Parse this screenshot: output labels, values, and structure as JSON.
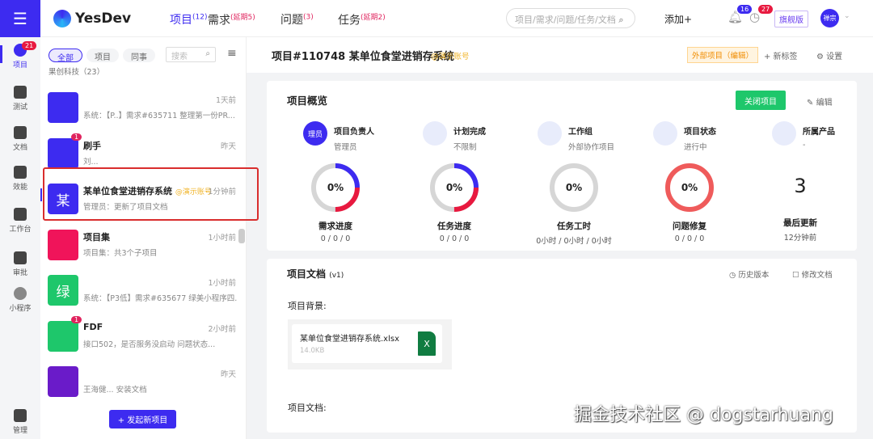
{
  "nav": {
    "logo": "YesDev",
    "tabs": [
      {
        "label": "项目",
        "count": "(12)"
      },
      {
        "label": "需求",
        "count": "(延期5)"
      },
      {
        "label": "问题",
        "count": "(3)"
      },
      {
        "label": "任务",
        "count": "(延期2)"
      }
    ],
    "search_placeholder": "项目/需求/问题/任务/文档",
    "add": "添加+",
    "bell_count": "16",
    "clock_count": "27",
    "edition": "旗舰版",
    "avatar": "禅宗"
  },
  "rail": [
    {
      "label": "项目",
      "badge": "21"
    },
    {
      "label": "测试"
    },
    {
      "label": "文档"
    },
    {
      "label": "效能"
    },
    {
      "label": "工作台"
    },
    {
      "label": "审批"
    },
    {
      "label": "小程序"
    },
    {
      "label": "管理"
    }
  ],
  "list": {
    "filters": [
      "全部",
      "项目",
      "同事"
    ],
    "search_placeholder": "搜索",
    "group": "果创科技（23）",
    "new_button": "+ 发起新项目",
    "items": [
      {
        "title": "",
        "sub": "系统：【P..】需求#635711 整理第一份PR...",
        "time": "1天前",
        "color": "#3d2bf0",
        "avatar": ""
      },
      {
        "title": "刷手",
        "sub": "刘...",
        "time": "昨天",
        "color": "#3d2bf0",
        "avatar": "",
        "badge": "1"
      },
      {
        "title": "某单位食堂进销存系统",
        "tag": "@演示账号",
        "sub": "管理员：更新了项目文档",
        "time": "1分钟前",
        "color": "#3d2bf0",
        "avatar": "某"
      },
      {
        "title": "项目集",
        "sub": "项目集：共3个子项目",
        "time": "1小时前",
        "color": "#f0145a",
        "avatar": ""
      },
      {
        "title": "",
        "sub": "系统：【P3低】需求#635677 绿美小程序四...",
        "time": "1小时前",
        "color": "#1ec76b",
        "avatar": "绿"
      },
      {
        "title": "FDF",
        "sub": "接口502，是否服务没启动 问题状态...",
        "time": "2小时前",
        "color": "#1ec76b",
        "avatar": "",
        "badge": "1"
      },
      {
        "title": "",
        "sub": "王海健... 安装文档",
        "time": "昨天",
        "color": "#6a1bc9",
        "avatar": ""
      }
    ]
  },
  "project": {
    "title": "项目#110748 某单位食堂进销存系统",
    "tag": "@演示账号",
    "external": "外部项目（编辑）",
    "new_tag": "+ 新标签",
    "settings": "设置"
  },
  "overview": {
    "title": "项目概览",
    "close": "关闭项目",
    "edit": "编辑",
    "stats": [
      {
        "label": "项目负责人",
        "value": "管理员",
        "icon": "理员"
      },
      {
        "label": "计划完成",
        "value": "不限制"
      },
      {
        "label": "工作组",
        "value": "外部协作项目"
      },
      {
        "label": "项目状态",
        "value": "进行中"
      },
      {
        "label": "所属产品",
        "value": "-"
      }
    ],
    "rings": [
      {
        "label": "需求进度",
        "detail": "0 / 0 / 0",
        "pct": "0%",
        "blue": 0.25,
        "red": 0.25
      },
      {
        "label": "任务进度",
        "detail": "0 / 0 / 0",
        "pct": "0%",
        "blue": 0.3,
        "red": 0.25
      },
      {
        "label": "任务工时",
        "detail": "0小时 / 0小时 / 0小时",
        "pct": "0%",
        "blue": 0,
        "red": 0
      },
      {
        "label": "问题修复",
        "detail": "0 / 0 / 0",
        "pct": "0%",
        "blue": 0,
        "red": 1
      }
    ],
    "last_update": {
      "value": "3",
      "label": "最后更新",
      "detail": "12分钟前"
    }
  },
  "docs": {
    "title": "项目文档",
    "version": "(v1)",
    "history": "历史版本",
    "modify": "修改文档",
    "background": "项目背景:",
    "file": {
      "name": "某单位食堂进销存系统.xlsx",
      "size": "14.0KB",
      "icon": "X"
    },
    "docs_label": "项目文档:"
  },
  "watermark": "掘金技术社区 @ dogstarhuang",
  "colors": {
    "brand": "#3d2bf0",
    "red": "#e8193f",
    "green": "#1ec76b"
  }
}
